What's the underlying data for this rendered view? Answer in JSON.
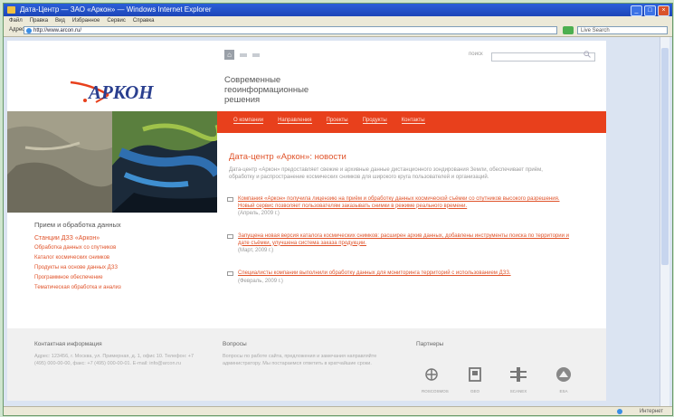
{
  "window": {
    "title": "Дата-Центр — ЗАО «Аркон» — Windows Internet Explorer",
    "controls": [
      "_",
      "□",
      "×"
    ]
  },
  "menubar": {
    "items": [
      "Файл",
      "Правка",
      "Вид",
      "Избранное",
      "Сервис",
      "Справка"
    ]
  },
  "addressbar": {
    "label": "Адрес",
    "url": "http://www.arcon.ru/",
    "search_placeholder": "Live Search"
  },
  "site": {
    "logo_text": "АРКОН",
    "tagline": [
      "Современные",
      "геоинформационные",
      "решения"
    ],
    "search_label": "поиск",
    "nav": [
      "О компании",
      "Направления",
      "Проекты",
      "Продукты",
      "Контакты"
    ],
    "heading": "Дата-центр «Аркон»: новости",
    "intro": "Дата-центр «Аркон» предоставляет свежие и архивные данные дистанционного зондирования Земли, обеспечивает приём, обработку и распространение космических снимков для широкого круга пользователей и организаций.",
    "news": [
      {
        "text": "Компания «Аркон» получила лицензию на приём и обработку данных космической съёмки со спутников высокого разрешения. Новый сервис позволяет пользователям заказывать снимки в режиме реального времени.",
        "date": "(Апрель, 2009 г.)"
      },
      {
        "text": "Запущена новая версия каталога космических снимков: расширен архив данных, добавлены инструменты поиска по территории и дате съёмки, улучшена система заказа продукции.",
        "date": "(Март, 2009 г.)"
      },
      {
        "text": "Специалисты компании выполнили обработку данных для мониторинга территорий с использованием ДЗЗ.",
        "date": "(Февраль, 2009 г.)"
      }
    ],
    "left_nav": {
      "head": "Прием и обработка данных",
      "items": [
        "Станции ДЗЗ «Аркон»",
        "Обработка данных со спутников",
        "Каталог космических снимков",
        "Продукты на основе данных ДЗЗ",
        "Программное обеспечение",
        "Тематическая обработка и анализ"
      ]
    },
    "footer": {
      "col1_title": "Контактная информация",
      "col1_text": "Адрес: 123456, г. Москва, ул. Примерная, д. 1, офис 10. Телефон: +7 (495) 000-00-00, факс: +7 (495) 000-00-01. E-mail: info@arcon.ru",
      "col2_title": "Вопросы",
      "col2_text": "Вопросы по работе сайта, предложения и замечания направляйте администратору. Мы постараемся ответить в кратчайшие сроки.",
      "col3_title": "Партнеры",
      "partners": [
        "ROSCOSMOS",
        "GEO",
        "SCANEX",
        "ESA"
      ]
    }
  },
  "status": {
    "zone": "Интернет"
  },
  "colors": {
    "accent": "#e8401c",
    "link": "#e0532a",
    "titlebar": "#2b5fd9"
  }
}
